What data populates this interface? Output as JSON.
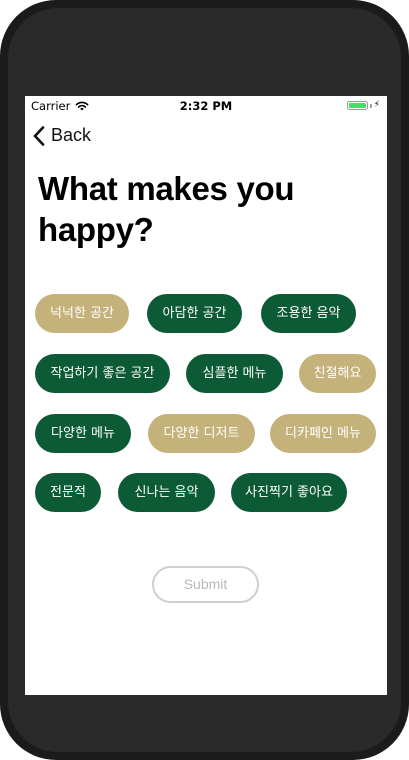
{
  "status_bar": {
    "carrier": "Carrier",
    "time": "2:32 PM",
    "battery_level": 1.0
  },
  "nav": {
    "back_label": "Back"
  },
  "title": "What makes you happy?",
  "tags": [
    {
      "label": "넉넉한 공간",
      "selected": false
    },
    {
      "label": "아담한 공간",
      "selected": true
    },
    {
      "label": "조용한 음악",
      "selected": true
    },
    {
      "label": "작업하기 좋은 공간",
      "selected": true
    },
    {
      "label": "심플한 메뉴",
      "selected": true
    },
    {
      "label": "친절해요",
      "selected": false
    },
    {
      "label": "다양한 메뉴",
      "selected": true
    },
    {
      "label": "다양한 디저트",
      "selected": false
    },
    {
      "label": "디카페인 메뉴",
      "selected": false
    },
    {
      "label": "전문적",
      "selected": true
    },
    {
      "label": "신나는 음악",
      "selected": true
    },
    {
      "label": "사진찍기 좋아요",
      "selected": true
    }
  ],
  "submit_label": "Submit",
  "colors": {
    "selected_tag": "#0d5a36",
    "unselected_tag": "#c4b27a",
    "battery": "#4cd964"
  }
}
